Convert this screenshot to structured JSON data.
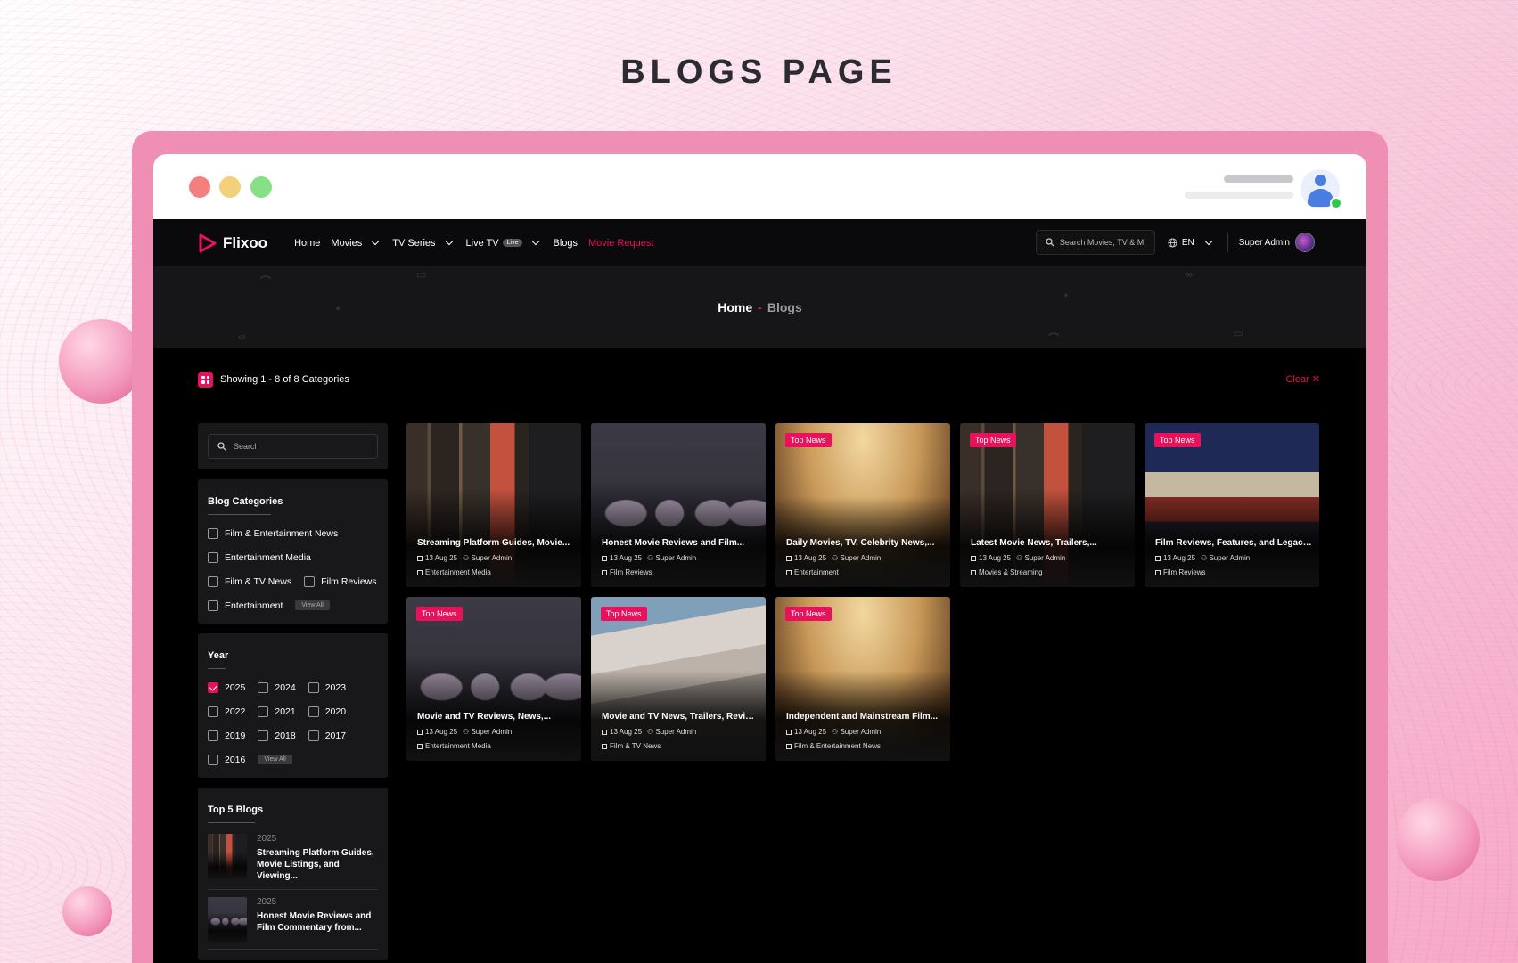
{
  "page_title": "BLOGS PAGE",
  "brand": "Flixoo",
  "nav": {
    "home": "Home",
    "movies": "Movies",
    "tv_series": "TV Series",
    "live_tv": "Live TV",
    "live_badge": "Live",
    "blogs": "Blogs",
    "movie_request": "Movie Request"
  },
  "search": {
    "placeholder": "Search Movies, TV & M"
  },
  "language": "EN",
  "user": "Super Admin",
  "breadcrumb": {
    "home": "Home",
    "separator": "-",
    "current": "Blogs"
  },
  "showing": "Showing 1 - 8 of 8 Categories",
  "clear": "Clear ✕",
  "sidebar": {
    "search_placeholder": "Search",
    "categories_title": "Blog Categories",
    "categories": [
      "Film & Entertainment News",
      "Entertainment Media",
      "Film & TV News",
      "Film Reviews",
      "Entertainment"
    ],
    "view_all": "View All",
    "year_title": "Year",
    "years": [
      "2025",
      "2024",
      "2023",
      "2022",
      "2021",
      "2020",
      "2019",
      "2018",
      "2017",
      "2016"
    ],
    "top_title": "Top 5 Blogs",
    "top": [
      {
        "year": "2025",
        "title": "Streaming Platform Guides, Movie Listings, and Viewing..."
      },
      {
        "year": "2025",
        "title": "Honest Movie Reviews and Film Commentary from..."
      }
    ]
  },
  "cards": [
    {
      "badge": "",
      "title": "Streaming Platform Guides, Movie...",
      "date": "13 Aug 25",
      "author": "Super Admin",
      "category": "Entertainment Media"
    },
    {
      "badge": "",
      "title": "Honest Movie Reviews and Film...",
      "date": "13 Aug 25",
      "author": "Super Admin",
      "category": "Film Reviews"
    },
    {
      "badge": "Top News",
      "title": "Daily Movies, TV, Celebrity News,...",
      "date": "13 Aug 25",
      "author": "Super Admin",
      "category": "Entertainment"
    },
    {
      "badge": "Top News",
      "title": "Latest Movie News, Trailers,...",
      "date": "13 Aug 25",
      "author": "Super Admin",
      "category": "Movies & Streaming"
    },
    {
      "badge": "Top News",
      "title": "Film Reviews, Features, and Legacy ...",
      "date": "13 Aug 25",
      "author": "Super Admin",
      "category": "Film Reviews"
    },
    {
      "badge": "Top News",
      "title": "Movie and TV Reviews, News,...",
      "date": "13 Aug 25",
      "author": "Super Admin",
      "category": "Entertainment Media"
    },
    {
      "badge": "Top News",
      "title": "Movie and TV News, Trailers, Review...",
      "date": "13 Aug 25",
      "author": "Super Admin",
      "category": "Film & TV News"
    },
    {
      "badge": "Top News",
      "title": "Independent and Mainstream Film...",
      "date": "13 Aug 25",
      "author": "Super Admin",
      "category": "Film & Entertainment News"
    }
  ],
  "colors": {
    "accent": "#e8115b",
    "background": "#000000",
    "panel": "#18181a"
  }
}
